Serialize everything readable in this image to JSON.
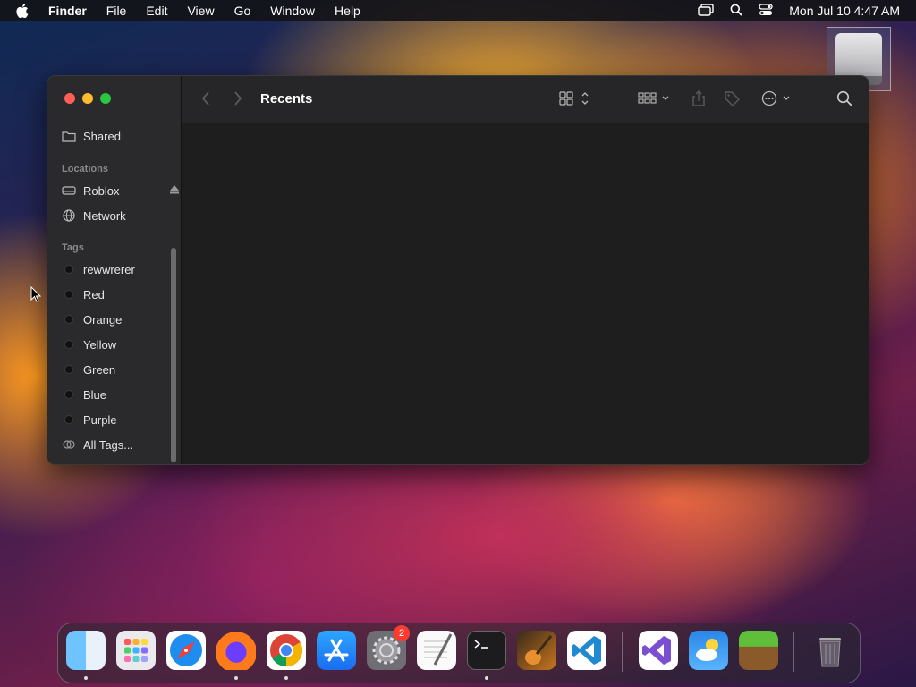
{
  "menubar": {
    "app_name": "Finder",
    "items": [
      "File",
      "Edit",
      "View",
      "Go",
      "Window",
      "Help"
    ],
    "clock": "Mon Jul 10  4:47 AM",
    "icons": [
      "apple-icon",
      "screen-mirroring-icon",
      "spotlight-search-icon",
      "control-center-icon"
    ]
  },
  "window": {
    "title": "Recents",
    "sidebar": {
      "shared_label": "Shared",
      "locations_header": "Locations",
      "locations": [
        {
          "label": "Roblox",
          "icon": "drive-icon"
        },
        {
          "label": "Network",
          "icon": "globe-icon"
        }
      ],
      "tags_header": "Tags",
      "tags": [
        {
          "label": "rewwrerer"
        },
        {
          "label": "Red"
        },
        {
          "label": "Orange"
        },
        {
          "label": "Yellow"
        },
        {
          "label": "Green"
        },
        {
          "label": "Blue"
        },
        {
          "label": "Purple"
        }
      ],
      "all_tags_label": "All Tags..."
    }
  },
  "dock": {
    "apps": [
      {
        "name": "Finder",
        "icon": "finder-icon",
        "running": true
      },
      {
        "name": "Launchpad",
        "icon": "launchpad-icon",
        "running": false
      },
      {
        "name": "Safari",
        "icon": "safari-icon",
        "running": false
      },
      {
        "name": "Firefox",
        "icon": "firefox-icon",
        "running": true
      },
      {
        "name": "Chrome",
        "icon": "chrome-icon",
        "running": true
      },
      {
        "name": "App Store",
        "icon": "app-store-icon",
        "running": false
      },
      {
        "name": "System Settings",
        "icon": "settings-icon",
        "running": false,
        "badge": "2"
      },
      {
        "name": "TextEdit",
        "icon": "textedit-icon",
        "running": false
      },
      {
        "name": "Terminal",
        "icon": "terminal-icon",
        "running": true
      },
      {
        "name": "GarageBand",
        "icon": "garageband-icon",
        "running": false
      },
      {
        "name": "VS Code",
        "icon": "vscode-icon",
        "running": false
      },
      {
        "name": "Visual Studio",
        "icon": "visual-studio-icon",
        "running": false
      },
      {
        "name": "Weather",
        "icon": "weather-icon",
        "running": false
      },
      {
        "name": "Minecraft",
        "icon": "minecraft-icon",
        "running": false
      },
      {
        "name": "Trash",
        "icon": "trash-icon",
        "running": false
      }
    ]
  }
}
